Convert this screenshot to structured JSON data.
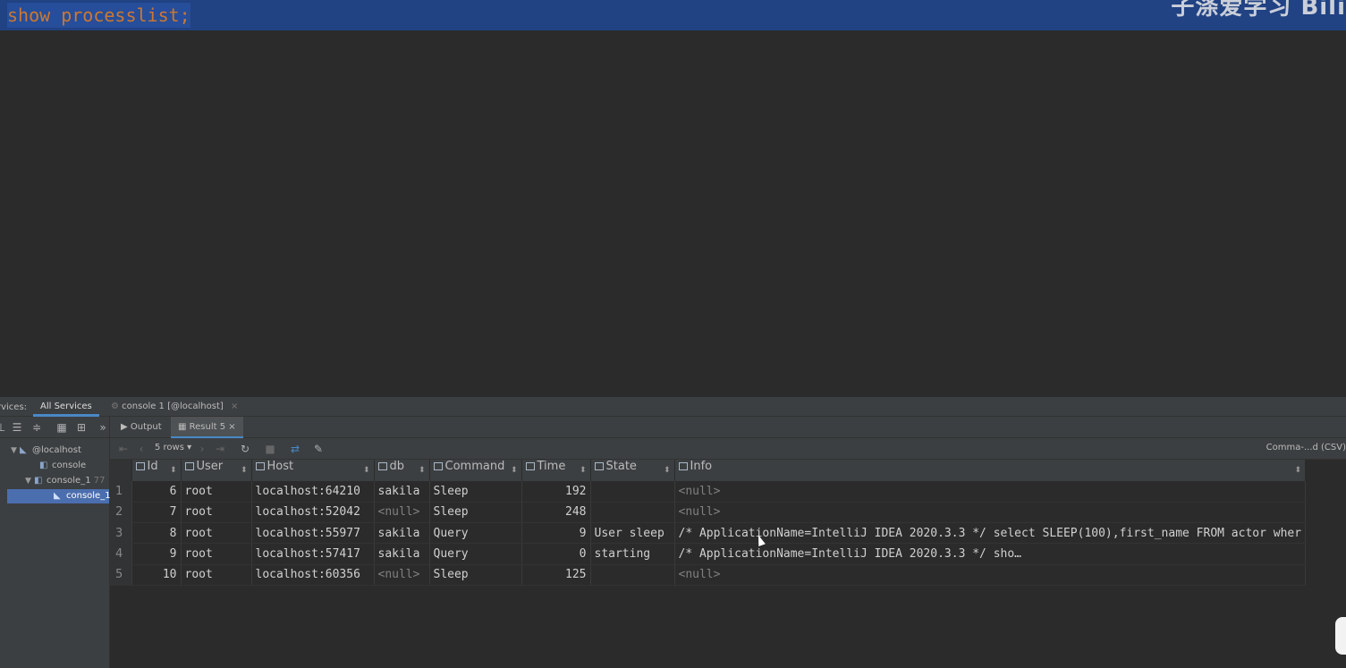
{
  "editor": {
    "code": "show processlist;",
    "watermark": "子涤爱学习 Bili"
  },
  "services": {
    "label": "rvices:",
    "tabs": [
      {
        "label": "All Services"
      },
      {
        "label": "console 1 [@localhost]"
      }
    ]
  },
  "tree": {
    "items": [
      {
        "label": "@localhost"
      },
      {
        "label": "console"
      },
      {
        "label": "console_1",
        "count": "77"
      },
      {
        "label": "console_1"
      }
    ]
  },
  "subtabs": {
    "output": "Output",
    "result": "Result 5"
  },
  "grid_toolbar": {
    "rows": "5 rows",
    "format": "Comma-...d (CSV)"
  },
  "table": {
    "columns": [
      "Id",
      "User",
      "Host",
      "db",
      "Command",
      "Time",
      "State",
      "Info"
    ],
    "rows": [
      {
        "n": "1",
        "id": "6",
        "user": "root",
        "host": "localhost:64210",
        "db": "sakila",
        "command": "Sleep",
        "time": "192",
        "state": "",
        "info": "<null>"
      },
      {
        "n": "2",
        "id": "7",
        "user": "root",
        "host": "localhost:52042",
        "db": "<null>",
        "command": "Sleep",
        "time": "248",
        "state": "",
        "info": "<null>"
      },
      {
        "n": "3",
        "id": "8",
        "user": "root",
        "host": "localhost:55977",
        "db": "sakila",
        "command": "Query",
        "time": "9",
        "state": "User sleep",
        "info": "/* ApplicationName=IntelliJ IDEA 2020.3.3 */ select SLEEP(100),first_name FROM actor wher"
      },
      {
        "n": "4",
        "id": "9",
        "user": "root",
        "host": "localhost:57417",
        "db": "sakila",
        "command": "Query",
        "time": "0",
        "state": "starting",
        "info": "/* ApplicationName=IntelliJ IDEA 2020.3.3 */ sho…"
      },
      {
        "n": "5",
        "id": "10",
        "user": "root",
        "host": "localhost:60356",
        "db": "<null>",
        "command": "Sleep",
        "time": "125",
        "state": "",
        "info": "<null>"
      }
    ]
  }
}
